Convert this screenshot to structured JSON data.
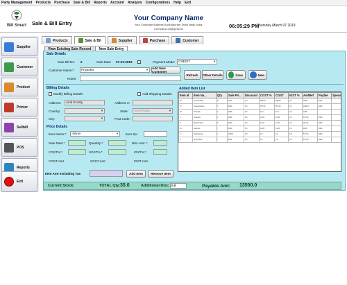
{
  "menu": [
    "Party Management",
    "Products",
    "Purchase",
    "Sale & Bill",
    "Reports",
    "Account",
    "Analysis",
    "Configurations",
    "Help",
    "Exit"
  ],
  "header": {
    "logo_text": "Bill Smart",
    "app_title": "Sale & Bill Entry",
    "company_name": "Your Company Name",
    "company_address": "Your Company Address,Kanchipuram,Tamil Nadu,India,",
    "company_email": "Company123@gmail.in",
    "clock": "06:05:29 PM",
    "date": "Thursday   March 07 2019"
  },
  "sidebar": [
    {
      "label": "Supplier",
      "color": "#3a7bd5"
    },
    {
      "label": "Customer",
      "color": "#3c9a4a"
    },
    {
      "label": "Product",
      "color": "#d98a2b"
    },
    {
      "label": "Printer",
      "color": "#c0392b"
    },
    {
      "label": "Sellbill",
      "color": "#8e44ad"
    },
    {
      "label": "POS",
      "color": "#555555"
    },
    {
      "label": "Reports",
      "color": "#2e86c1"
    },
    {
      "label": "Exit",
      "color": "#d11111"
    }
  ],
  "tabs": [
    {
      "label": "Products",
      "color": "#7a9bd0"
    },
    {
      "label": "Sale & Bil",
      "color": "#5a8f3a"
    },
    {
      "label": "Supplier",
      "color": "#d28a34"
    },
    {
      "label": "Purchase",
      "color": "#b4483a"
    },
    {
      "label": "Customer",
      "color": "#3a6fb0"
    }
  ],
  "subtabs": [
    "View Existing Sale Record",
    "New Sale Entry"
  ],
  "sale_details": {
    "section": "Sale Details",
    "bill_no_label": "Sale Bill No:",
    "bill_no_value": "6",
    "date_label": "Sale Date:",
    "date_value": "07-03-2019",
    "payment_label": "Payment Mode:",
    "payment_value": "CREDIT",
    "customer_label": "Customer Name:*",
    "customer_value": "Priyanka",
    "add_customer": "Add New Customer",
    "notes_label": "Notes:",
    "refresh": "Refresh",
    "other_details": "Other Details",
    "save": "Save",
    "new": "New"
  },
  "billing": {
    "section": "Billing Details",
    "modify_label": "Modify Billing Details",
    "shipping_label": "Add Shipping Details",
    "address_label": "Address:",
    "address_value": "Amit Ecosty",
    "address2_label": "Address 2:",
    "country_label": "Country:",
    "state_label": "State:",
    "state_value": "Tamil Nadu",
    "city_label": "City:",
    "postcode_label": "Post Code:"
  },
  "price": {
    "section": "Price Details",
    "item_name_label": "Item Name:*",
    "item_name_value": "-None-",
    "item_sp_label": "Item Sp.:",
    "sale_rate_label": "Sale Rate:*",
    "quantity_label": "Quantity:*",
    "disc_label": "Disc.Amt.:*",
    "cgst_label": "CGST%:*",
    "sgst_label": "SGST%:*",
    "igst_label": "IGST%:*",
    "cgst_amt_label": "CGST Amt.",
    "sgst_amt_label": "SGST Amt.",
    "igst_amt_label": "IGST Amt.",
    "item_amt_label": "Item Amt excluding Tax",
    "add_item": "Add Item",
    "remove_item": "Remove Item"
  },
  "items": {
    "section": "Added Item List",
    "columns": [
      "Item Id",
      "Item Na...",
      "Qty",
      "Sale Pri...",
      "Discount",
      "CGST %",
      "CGST",
      "IGST %",
      "AmtBef",
      "Payble",
      "Specs"
    ],
    "rows": [
      [
        "20",
        "hmCrocodale",
        "11",
        "2000",
        "0.0",
        "258.00",
        "258.00",
        "0.0",
        "1999",
        "2000",
        ""
      ],
      [
        "17",
        "PepperCruhse",
        "5",
        "2000",
        "0.0",
        "357.00",
        "357.00",
        "0.0",
        "2499.77",
        "2000",
        ""
      ],
      [
        "18",
        "Refrotide",
        "4",
        "2000",
        "0.0",
        "67.1",
        "67.1",
        "0.0",
        "1025",
        "",
        ""
      ],
      [
        "9",
        "ProductA",
        "4",
        "2000",
        "0.0",
        "12.25",
        "12.25",
        "0.0",
        "877.80",
        "2000",
        ""
      ],
      [
        "5",
        "BetterCruhse",
        "5",
        "2000",
        "0.0",
        "14.07",
        "14.07",
        "0.0",
        "111.45",
        "2000",
        ""
      ],
      [
        "21",
        "LamitTec",
        "7",
        "2000",
        "0.0",
        "19.25",
        "19.25",
        "0.0",
        "1000",
        "2000",
        ""
      ],
      [
        "3",
        "PeidoCruhse",
        "1",
        "15000",
        "0.0",
        "0.0",
        "0.0",
        "0.0",
        "677.00",
        "2000",
        ""
      ],
      [
        "4",
        "Sn Scoboor",
        "7",
        "2000",
        "0.0",
        "0.0",
        "0.0",
        "0.0",
        "677.00",
        "2000",
        ""
      ]
    ]
  },
  "footer": {
    "stock_label": "Current Stock:",
    "total_qty_label": "TOTAL Qty:",
    "total_qty_value": "35.0",
    "addl_disc_label": "Additional Disc.:",
    "addl_disc_value": "0.0",
    "payable_label": "Payable Amt:",
    "payable_value": "13500.0"
  }
}
